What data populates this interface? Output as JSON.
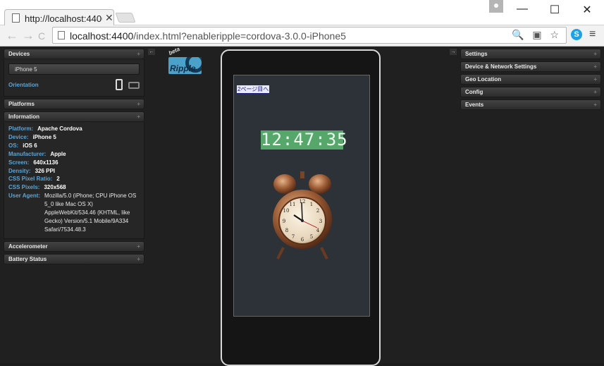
{
  "browser": {
    "tab_title": "http://localhost:4400",
    "tab_close": "✕",
    "window_controls": {
      "minimize": "—",
      "maximize": "☐",
      "close": "✕"
    },
    "nav": {
      "back": "←",
      "forward": "→",
      "reload": "C"
    },
    "url_host": "localhost:4400",
    "url_rest": "/index.html?enableripple=cordova-3.0.0-iPhone5",
    "omni_icons": "🔍 ▣ ☆",
    "skype_label": "S",
    "menu_icon": "≡"
  },
  "left_panel": {
    "devices_header": "Devices",
    "device_selected": "iPhone 5",
    "orientation_label": "Orientation",
    "platforms_header": "Platforms",
    "information_header": "Information",
    "info": [
      {
        "key": "Platform:",
        "value": "Apache Cordova"
      },
      {
        "key": "Device:",
        "value": "iPhone 5"
      },
      {
        "key": "OS:",
        "value": "iOS 6"
      },
      {
        "key": "Manufacturer:",
        "value": "Apple"
      },
      {
        "key": "Screen:",
        "value": "640x1136"
      },
      {
        "key": "Density:",
        "value": "326 PPI"
      },
      {
        "key": "CSS Pixel Ratio:",
        "value": "2"
      },
      {
        "key": "CSS Pixels:",
        "value": "320x568"
      }
    ],
    "user_agent_key": "User Agent:",
    "user_agent_value": "Mozilla/5.0 (iPhone; CPU iPhone OS 5_0 like Mac OS X) AppleWebKit/534.46 (KHTML, like Gecko) Version/5.1 Mobile/9A334 Safari/7534.48.3",
    "accelerometer_header": "Accelerometer",
    "battery_header": "Battery Status",
    "plus": "+"
  },
  "right_panel": {
    "headers": [
      "Settings",
      "Device & Network Settings",
      "Geo Location",
      "Config",
      "Events"
    ],
    "plus": "+"
  },
  "logo": {
    "beta": "beta",
    "name": "Ripple"
  },
  "device_screen": {
    "page_link": "2ページ目へ",
    "digital_time": "12:47:35"
  },
  "arrows": {
    "left": "←",
    "right": "→"
  },
  "colors": {
    "accent_label": "#5aa6d6",
    "digital_bg": "#56a86a",
    "logo_bg": "#4aa1c9"
  }
}
